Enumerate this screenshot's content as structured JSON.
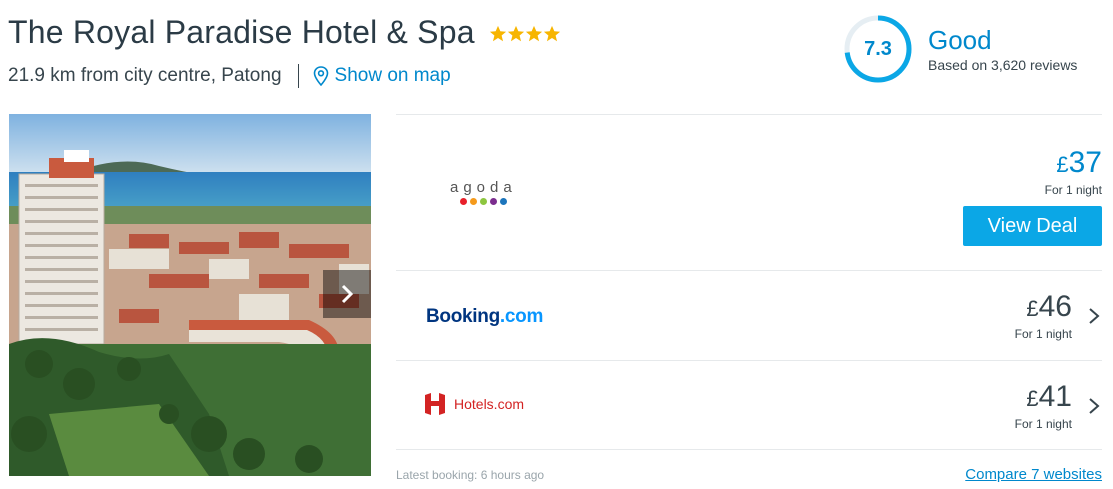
{
  "hotel": {
    "name": "The Royal Paradise Hotel & Spa",
    "star_rating": 4,
    "distance": "21.9 km from city centre, Patong",
    "map_link": "Show on map"
  },
  "rating": {
    "score": "7.3",
    "fill_fraction": 0.73,
    "label": "Good",
    "reviews": "Based on 3,620 reviews"
  },
  "photo": {
    "next_icon": "chevron-right-icon"
  },
  "deals": [
    {
      "provider": "agoda",
      "logo_text": "agoda",
      "currency": "£",
      "amount": "37",
      "per_night": "For 1 night",
      "button_label": "View Deal"
    },
    {
      "provider": "Booking.com",
      "logo_main": "Booking",
      "logo_suffix": ".com",
      "currency": "£",
      "amount": "46",
      "per_night": "For 1 night"
    },
    {
      "provider": "Hotels.com",
      "logo_text": "Hotels.com",
      "currency": "£",
      "amount": "41",
      "per_night": "For 1 night"
    }
  ],
  "footer": {
    "latest_booking": "Latest booking: 6 hours ago",
    "compare_link": "Compare 7 websites"
  },
  "colors": {
    "accent": "#0088cc",
    "button": "#0ba7e6",
    "star": "#f7b500"
  }
}
